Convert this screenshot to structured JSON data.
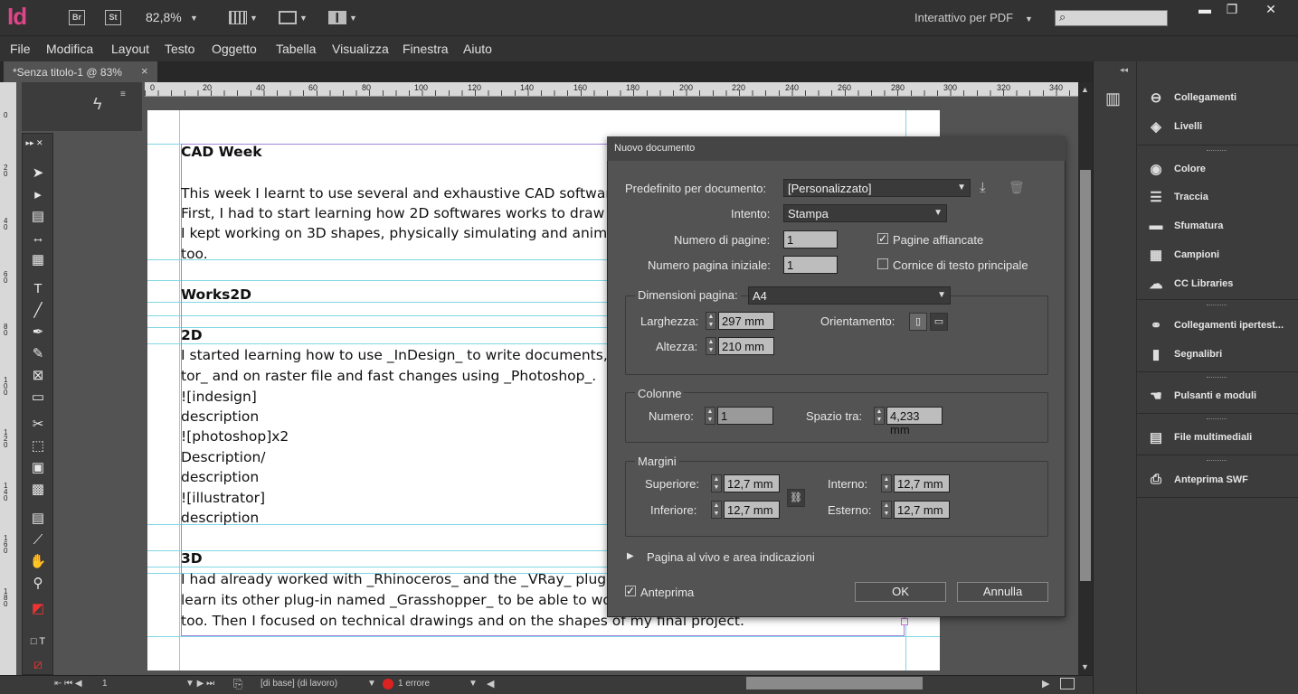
{
  "app": {
    "logo": "Id",
    "bridge": "Br",
    "stock": "St",
    "zoom": "82,8%",
    "workspace": "Interattivo per PDF",
    "win_min": "▬",
    "win_max": "❐",
    "win_close": "✕"
  },
  "menu": [
    "File",
    "Modifica",
    "Layout",
    "Testo",
    "Oggetto",
    "Tabella",
    "Visualizza",
    "Finestra",
    "Aiuto"
  ],
  "tab": {
    "title": "*Senza titolo-1 @ 83%",
    "close": "×"
  },
  "ruler_h": [
    "0",
    "20",
    "40",
    "60",
    "80",
    "100",
    "120",
    "140",
    "160",
    "180",
    "200",
    "220",
    "240",
    "260",
    "280",
    "300",
    "320",
    "340"
  ],
  "ruler_v": [
    "0",
    "20",
    "40",
    "60",
    "80",
    "100",
    "120",
    "140",
    "160",
    "180"
  ],
  "document": {
    "lines": [
      {
        "text": "CAD Week",
        "bold": true
      },
      {
        "text": "This week I learnt to use several and exhaustive CAD softwares",
        "bold": false
      },
      {
        "text": "First, I had to start learning how 2D softwares works to draw te",
        "bold": false
      },
      {
        "text": "I kept working on 3D shapes, physically simulating and animat",
        "bold": false
      },
      {
        "text": "too.",
        "bold": false
      },
      {
        "text": "Works2D",
        "bold": true
      },
      {
        "text": "2D",
        "bold": true
      },
      {
        "text": "I started learning how to use _InDesign_ to write documents, ",
        "bold": false
      },
      {
        "text": "tor_ and on raster file and fast changes using _Photoshop_.",
        "bold": false
      },
      {
        "text": "![indesign]",
        "bold": false
      },
      {
        "text": "description",
        "bold": false
      },
      {
        "text": "![photoshop]x2",
        "bold": false
      },
      {
        "text": "Description/",
        "bold": false
      },
      {
        "text": "description",
        "bold": false
      },
      {
        "text": "![illustrator]",
        "bold": false
      },
      {
        "text": "description",
        "bold": false
      },
      {
        "text": "3D",
        "bold": true
      },
      {
        "text": "I had already worked with _Rhinoceros_ and the _VRay_ plug-",
        "bold": false
      },
      {
        "text": "learn its other plug-in named _Grasshopper_ to be able to wo",
        "bold": false
      },
      {
        "text": "too. Then I focused on  technical drawings and on the shapes of my final project.",
        "bold": false
      }
    ]
  },
  "dialog": {
    "title": "Nuovo documento",
    "preset_label": "Predefinito per documento:",
    "preset_value": "[Personalizzato]",
    "intent_label": "Intento:",
    "intent_value": "Stampa",
    "pages_label": "Numero di pagine:",
    "pages_value": "1",
    "start_label": "Numero pagina iniziale:",
    "start_value": "1",
    "facing_label": "Pagine affiancate",
    "facing_checked": true,
    "primary_label": "Cornice di testo principale",
    "primary_checked": false,
    "size_label": "Dimensioni pagina:",
    "size_value": "A4",
    "width_label": "Larghezza:",
    "width_value": "297 mm",
    "height_label": "Altezza:",
    "height_value": "210 mm",
    "orient_label": "Orientamento:",
    "columns_group": "Colonne",
    "col_num_label": "Numero:",
    "col_num_value": "1",
    "gutter_label": "Spazio tra:",
    "gutter_value": "4,233 mm",
    "margins_group": "Margini",
    "top_label": "Superiore:",
    "top_value": "12,7 mm",
    "bottom_label": "Inferiore:",
    "bottom_value": "12,7 mm",
    "inside_label": "Interno:",
    "inside_value": "12,7 mm",
    "outside_label": "Esterno:",
    "outside_value": "12,7 mm",
    "bleed_label": "Pagina al vivo e area indicazioni",
    "preview_label": "Anteprima",
    "preview_checked": true,
    "ok": "OK",
    "cancel": "Annulla"
  },
  "panels": [
    {
      "label": "Collegamenti",
      "icon": "link-icon"
    },
    {
      "label": "Livelli",
      "icon": "layers-icon"
    },
    {
      "label": "Colore",
      "icon": "color-icon"
    },
    {
      "label": "Traccia",
      "icon": "stroke-icon"
    },
    {
      "label": "Sfumatura",
      "icon": "gradient-icon"
    },
    {
      "label": "Campioni",
      "icon": "swatches-icon"
    },
    {
      "label": "CC Libraries",
      "icon": "cc-libraries-icon"
    },
    {
      "label": "Collegamenti ipertest...",
      "icon": "hyperlinks-icon"
    },
    {
      "label": "Segnalibri",
      "icon": "bookmarks-icon"
    },
    {
      "label": "Pulsanti e moduli",
      "icon": "buttons-icon"
    },
    {
      "label": "File multimediali",
      "icon": "media-icon"
    },
    {
      "label": "Anteprima SWF",
      "icon": "swf-preview-icon"
    }
  ],
  "status": {
    "page": "1",
    "master": "[di base] (di lavoro)",
    "errors": "1 errore"
  }
}
